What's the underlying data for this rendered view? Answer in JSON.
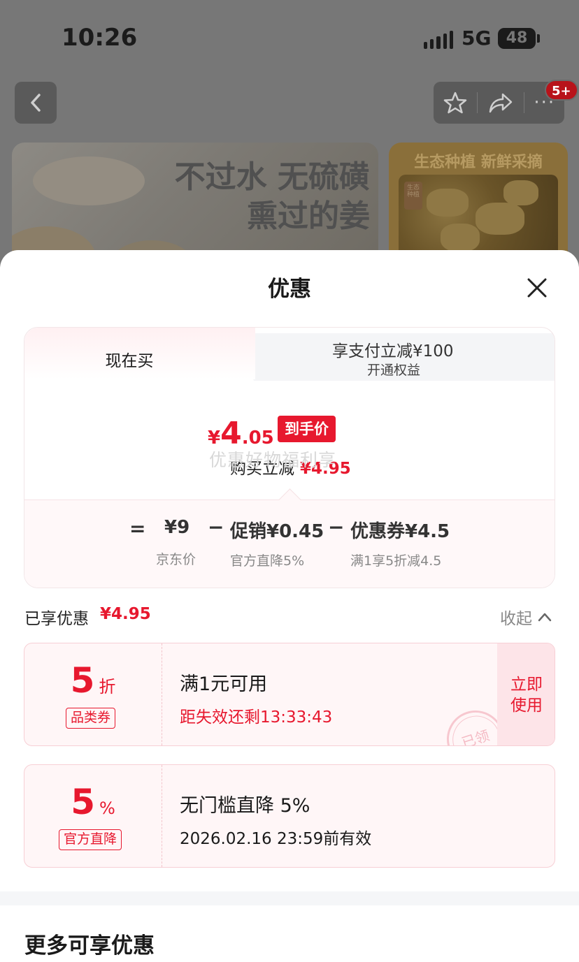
{
  "status_bar": {
    "time": "10:26",
    "network": "5G",
    "battery": "48"
  },
  "product_page": {
    "badge": "5+",
    "banner_left_lines": [
      "不过水 无硫磺",
      "熏过的姜"
    ],
    "banner_right_title": "生态种植 新鲜采摘",
    "seal_text": "生态种植"
  },
  "sheet": {
    "title": "优惠",
    "tabs": {
      "active": "现在买",
      "inactive_main": "享支付立减¥100",
      "inactive_sub": "开通权益"
    },
    "final_price": {
      "currency": "¥",
      "integer": "4",
      "decimal": ".05",
      "tag": "到手价"
    },
    "watermark": "优惠好物福利享",
    "buy_reduce": {
      "label": "购买立减",
      "amount": "¥4.95"
    },
    "formula": {
      "eq": "=",
      "jd_price": "¥9",
      "jd_price_label": "京东价",
      "minus1": "−",
      "promo": "促销¥0.45",
      "promo_label": "官方直降5%",
      "minus2": "−",
      "coupon": "优惠券¥4.5",
      "coupon_label": "满1享5折减4.5"
    },
    "enjoyed": {
      "label": "已享优惠",
      "amount": "¥4.95",
      "collapse": "收起"
    },
    "coupons": [
      {
        "value": "5",
        "unit": "折",
        "tag": "品类券",
        "title": "满1元可用",
        "subtitle": "距失效还剩13:33:43",
        "button": "立即使用",
        "button_line1": "立即",
        "button_line2": "使用",
        "stamp": "已领"
      },
      {
        "value": "5",
        "unit": "%",
        "tag": "官方直降",
        "title": "无门槛直降 5%",
        "subtitle": "2026.02.16 23:59前有效"
      }
    ],
    "more_title": "更多可享优惠"
  },
  "colors": {
    "accent": "#e7182e",
    "coupon_bg": "#fff6f7",
    "coupon_border": "#f7cfd5"
  },
  "icons": [
    "back-icon",
    "star-icon",
    "share-icon",
    "more-icon",
    "close-icon",
    "chevron-up-icon"
  ]
}
